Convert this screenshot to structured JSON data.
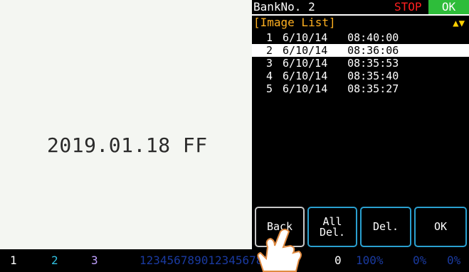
{
  "camera": {
    "text": "2019.01.18 FF"
  },
  "header": {
    "bank_label": "BankNo. 2",
    "status": "STOP",
    "ok": "OK",
    "list_title": "[Image List]",
    "nav_arrows": "▲▼"
  },
  "images": [
    {
      "num": "1",
      "date": "6/10/14",
      "time": "08:40:00",
      "selected": false
    },
    {
      "num": "2",
      "date": "6/10/14",
      "time": "08:36:06",
      "selected": true
    },
    {
      "num": "3",
      "date": "6/10/14",
      "time": "08:35:53",
      "selected": false
    },
    {
      "num": "4",
      "date": "6/10/14",
      "time": "08:35:40",
      "selected": false
    },
    {
      "num": "5",
      "date": "6/10/14",
      "time": "08:35:27",
      "selected": false
    }
  ],
  "buttons": {
    "back": "Back",
    "all_del_1": "All",
    "all_del_2": "Del.",
    "del": "Del.",
    "ok": "OK"
  },
  "status_bar": {
    "slot1": "1",
    "slot2": "2",
    "slot3": "3",
    "sequence": "12345678901234567890",
    "count": "0",
    "pct1": "100%",
    "pct2": "0%",
    "pct3": "0%"
  },
  "colors": {
    "ok_bg": "#2ebd3a",
    "stop": "#ff2020",
    "title": "#ffb020",
    "button_border": "#2aa0d0"
  }
}
